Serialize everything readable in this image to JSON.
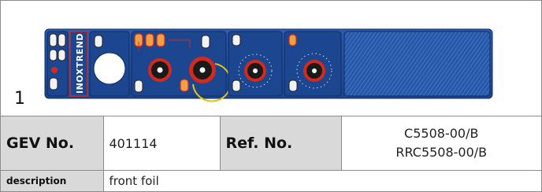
{
  "figure": {
    "index": "1",
    "brand_text": "INOXTREND"
  },
  "table": {
    "gev_label": "GEV No.",
    "gev_value": "401114",
    "ref_label": "Ref. No.",
    "ref_values": [
      "C5508-00/B",
      "RRC5508-00/B"
    ],
    "description_label": "description",
    "description_value": "front foil"
  },
  "colors": {
    "panel_blue": "#1f4fa0",
    "panel_dark": "#163a7a",
    "accent_red": "#d42a1e",
    "knob_black": "#1a1a1a",
    "ring_yellow": "#e3c21a",
    "label_gray": "#d9d9d9"
  }
}
